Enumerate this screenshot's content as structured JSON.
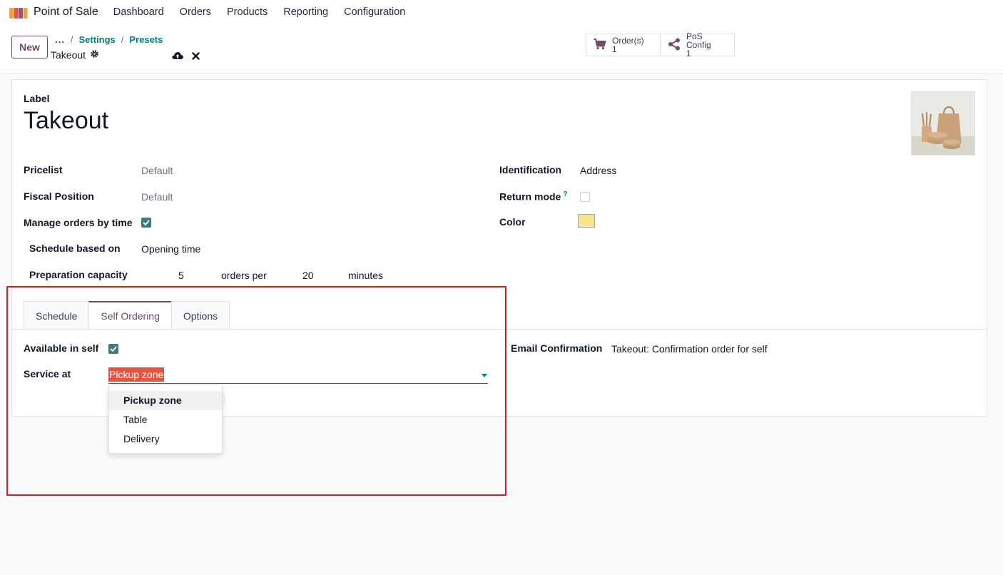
{
  "nav": {
    "app_name": "Point of Sale",
    "menu": [
      "Dashboard",
      "Orders",
      "Products",
      "Reporting",
      "Configuration"
    ]
  },
  "control": {
    "new_label": "New",
    "breadcrumb_dots": "...",
    "breadcrumb": [
      "Settings",
      "Presets"
    ],
    "record_name": "Takeout",
    "smart_buttons": [
      {
        "icon": "cart-icon",
        "label": "Order(s)",
        "count": "1"
      },
      {
        "icon": "share-icon",
        "label": "PoS Config",
        "count": "1"
      }
    ]
  },
  "form": {
    "label_caption": "Label",
    "title": "Takeout",
    "pricelist_label": "Pricelist",
    "pricelist_value": "Default",
    "fiscal_label": "Fiscal Position",
    "fiscal_value": "Default",
    "manage_label": "Manage orders by time",
    "manage_checked": true,
    "schedule_label": "Schedule based on",
    "schedule_value": "Opening time",
    "capacity_label": "Preparation capacity",
    "capacity_orders": "5",
    "capacity_orders_per": "orders per",
    "capacity_minutes": "20",
    "capacity_minutes_label": "minutes",
    "identification_label": "Identification",
    "identification_value": "Address",
    "return_label": "Return mode",
    "return_help": "?",
    "return_checked": false,
    "color_label": "Color",
    "color_value": "#fde38a"
  },
  "tabs": [
    "Schedule",
    "Self Ordering",
    "Options"
  ],
  "self_ordering": {
    "available_label": "Available in self",
    "available_checked": true,
    "service_label": "Service at",
    "service_value": "Pickup zone",
    "email_label": "Email Confirmation",
    "email_value": "Takeout: Confirmation order for self",
    "options": [
      "Pickup zone",
      "Table",
      "Delivery"
    ]
  },
  "colors": {
    "brand": "#714b67",
    "accent": "#017e84",
    "highlight": "#e0191e"
  }
}
